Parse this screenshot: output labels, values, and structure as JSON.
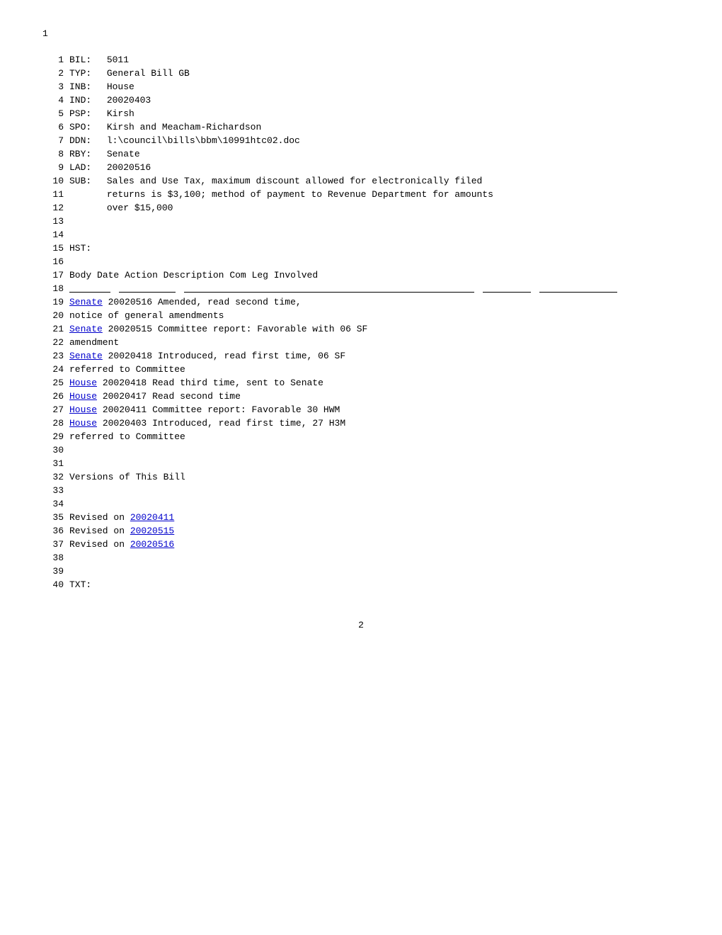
{
  "page": {
    "top_number": "1",
    "bottom_number": "2"
  },
  "bill": {
    "fields": [
      {
        "num": "1",
        "label": "BIL:",
        "value": "5011"
      },
      {
        "num": "2",
        "label": "TYP:",
        "value": "General Bill GB"
      },
      {
        "num": "3",
        "label": "INB:",
        "value": "House"
      },
      {
        "num": "4",
        "label": "IND:",
        "value": "20020403"
      },
      {
        "num": "5",
        "label": "PSP:",
        "value": "Kirsh"
      },
      {
        "num": "6",
        "label": "SPO:",
        "value": "Kirsh and Meacham-Richardson"
      },
      {
        "num": "7",
        "label": "DDN:",
        "value": "l:\\council\\bills\\bbm\\10991htc02.doc"
      },
      {
        "num": "8",
        "label": "RBY:",
        "value": "Senate"
      },
      {
        "num": "9",
        "label": "LAD:",
        "value": "20020516"
      },
      {
        "num": "10",
        "label": "SUB:",
        "value": "Sales and Use Tax, maximum discount allowed for electronically filed"
      },
      {
        "num": "11",
        "label": "",
        "value": "returns is $3,100; method of payment to Revenue Department for amounts"
      },
      {
        "num": "12",
        "label": "",
        "value": "over $15,000"
      }
    ],
    "empty_lines": [
      "13",
      "14"
    ],
    "hst_line": "15",
    "empty_line_16": "16"
  },
  "history": {
    "header": {
      "line_num": "17",
      "body": "Body",
      "date": "Date",
      "action": "Action Description",
      "com": "Com",
      "leg": "Leg Involved"
    },
    "empty_line_18": "18",
    "rows": [
      {
        "num": "19",
        "body": "Senate",
        "body_link": true,
        "date": "20020516",
        "action": "Amended, read second time,",
        "com": "",
        "leg": ""
      },
      {
        "num": "20",
        "body": "",
        "body_link": false,
        "date": "",
        "action": "notice of general amendments",
        "com": "",
        "leg": ""
      },
      {
        "num": "21",
        "body": "Senate",
        "body_link": true,
        "date": "20020515",
        "action": "Committee report: Favorable with",
        "com": "06 SF",
        "leg": ""
      },
      {
        "num": "22",
        "body": "",
        "body_link": false,
        "date": "",
        "action": "amendment",
        "com": "",
        "leg": ""
      },
      {
        "num": "23",
        "body": "Senate",
        "body_link": true,
        "date": "20020418",
        "action": "Introduced, read first time,",
        "com": "06 SF",
        "leg": ""
      },
      {
        "num": "24",
        "body": "",
        "body_link": false,
        "date": "",
        "action": "referred to Committee",
        "com": "",
        "leg": ""
      },
      {
        "num": "25",
        "body": "House",
        "body_link": true,
        "date": "20020418",
        "action": "Read third time, sent to Senate",
        "com": "",
        "leg": ""
      },
      {
        "num": "26",
        "body": "House",
        "body_link": true,
        "date": "20020417",
        "action": "Read second time",
        "com": "",
        "leg": ""
      },
      {
        "num": "27",
        "body": "House",
        "body_link": true,
        "date": "20020411",
        "action": "Committee report: Favorable",
        "com": "30 HWM",
        "leg": ""
      },
      {
        "num": "28",
        "body": "House",
        "body_link": true,
        "date": "20020403",
        "action": "Introduced, read first time,",
        "com": "27 H3M",
        "leg": ""
      },
      {
        "num": "29",
        "body": "",
        "body_link": false,
        "date": "",
        "action": "referred to Committee",
        "com": "",
        "leg": ""
      }
    ],
    "empty_lines_after": [
      "30",
      "31"
    ]
  },
  "versions": {
    "line_num": "32",
    "title": "Versions of This Bill",
    "empty_line_33": "33",
    "empty_line_34": "34",
    "items": [
      {
        "num": "35",
        "prefix": "Revised on ",
        "date": "20020411",
        "link": true
      },
      {
        "num": "36",
        "prefix": "Revised on ",
        "date": "20020515",
        "link": true
      },
      {
        "num": "37",
        "prefix": "Revised on ",
        "date": "20020516",
        "link": true
      }
    ],
    "empty_lines_after": [
      "38",
      "39"
    ]
  },
  "txt": {
    "line_num": "40",
    "label": "TXT:"
  }
}
